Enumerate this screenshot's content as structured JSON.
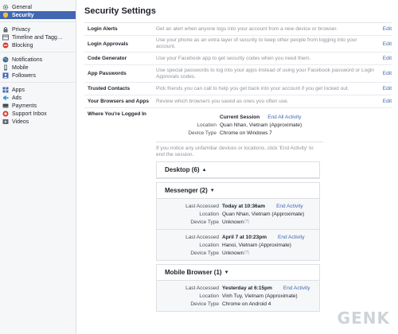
{
  "sidebar": {
    "groups": [
      [
        {
          "label": "General",
          "icon": "gear-icon"
        },
        {
          "label": "Security",
          "icon": "shield-icon",
          "active": true
        }
      ],
      [
        {
          "label": "Privacy",
          "icon": "lock-icon"
        },
        {
          "label": "Timeline and Tagg…",
          "icon": "timeline-icon"
        },
        {
          "label": "Blocking",
          "icon": "block-icon"
        }
      ],
      [
        {
          "label": "Notifications",
          "icon": "globe-icon"
        },
        {
          "label": "Mobile",
          "icon": "mobile-icon"
        },
        {
          "label": "Followers",
          "icon": "followers-icon"
        }
      ],
      [
        {
          "label": "Apps",
          "icon": "apps-icon"
        },
        {
          "label": "Ads",
          "icon": "ads-icon"
        },
        {
          "label": "Payments",
          "icon": "payments-icon"
        },
        {
          "label": "Support Inbox",
          "icon": "support-icon"
        },
        {
          "label": "Videos",
          "icon": "video-icon"
        }
      ]
    ]
  },
  "page": {
    "title": "Security Settings"
  },
  "settings": [
    {
      "title": "Login Alerts",
      "desc": "Get an alert when anyone logs into your account from a new device or browser.",
      "edit": "Edit"
    },
    {
      "title": "Login Approvals",
      "desc": "Use your phone as an extra layer of security to keep other people from logging into your account.",
      "edit": "Edit"
    },
    {
      "title": "Code Generator",
      "desc": "Use your Facebook app to get security codes when you need them.",
      "edit": "Edit"
    },
    {
      "title": "App Passwords",
      "desc": "Use special passwords to log into your apps instead of using your Facebook password or Login Approvals codes.",
      "edit": "Edit"
    },
    {
      "title": "Trusted Contacts",
      "desc": "Pick friends you can call to help you get back into your account if you get locked out.",
      "edit": "Edit"
    },
    {
      "title": "Your Browsers and Apps",
      "desc": "Review which browsers you saved as ones you often use.",
      "edit": "Edit"
    }
  ],
  "where": {
    "title": "Where You're Logged In",
    "current": {
      "heading": "Current Session",
      "end_all": "End All Activity",
      "location_label": "Location",
      "location": "Quan Nhan, Vietnam (Approximate)",
      "device_label": "Device Type",
      "device": "Chrome on Windows 7"
    },
    "hint": "If you notice any unfamiliar devices or locations, click 'End Activity' to end the session.",
    "desktop": {
      "label": "Desktop (6)",
      "caret": "▲"
    },
    "messenger": {
      "label": "Messenger (2)",
      "caret": "▼",
      "sessions": [
        {
          "accessed_label": "Last Accessed",
          "accessed": "Today at 10:36am",
          "end": "End Activity",
          "location_label": "Location",
          "location": "Quan Nhan, Vietnam (Approximate)",
          "device_label": "Device Type",
          "device": "Unknown",
          "q": "[?]"
        },
        {
          "accessed_label": "Last Accessed",
          "accessed": "April 7 at 10:23pm",
          "end": "End Activity",
          "location_label": "Location",
          "location": "Hanoi, Vietnam (Approximate)",
          "device_label": "Device Type",
          "device": "Unknown",
          "q": "[?]"
        }
      ]
    },
    "mobile": {
      "label": "Mobile Browser (1)",
      "caret": "▼",
      "sessions": [
        {
          "accessed_label": "Last Accessed",
          "accessed": "Yesterday at 6:15pm",
          "end": "End Activity",
          "location_label": "Location",
          "location": "Vinh Tuy, Vietnam (Approximate)",
          "device_label": "Device Type",
          "device": "Chrome on Android 4"
        }
      ]
    }
  },
  "watermark": "GENK"
}
